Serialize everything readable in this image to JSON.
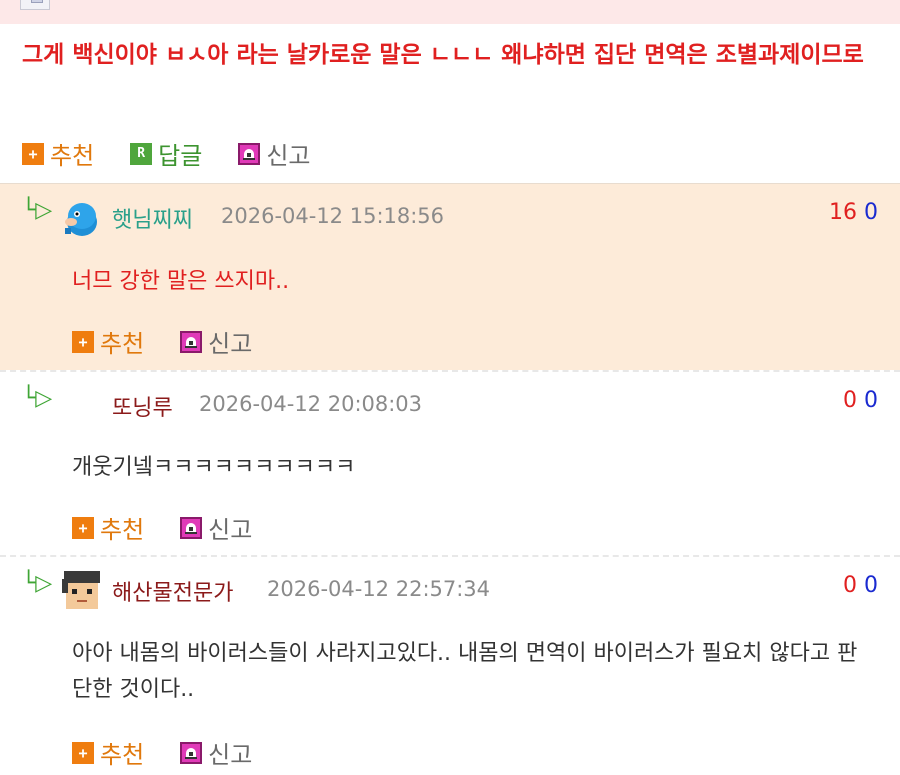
{
  "post": {
    "text": "그게 백신이야 ㅂㅅ아 라는 날카로운 말은 ㄴㄴㄴ 왜냐하면 집단 면역은 조별과제이므로",
    "actions": {
      "recommend": "추천",
      "reply": "답글",
      "report": "신고"
    }
  },
  "comments": [
    {
      "nick": "햇님찌찌",
      "date": "2026-04-12 15:18:56",
      "up": "16",
      "down": "0",
      "text": "너므 강한 말은 쓰지마..",
      "recommend": "추천",
      "report": "신고"
    },
    {
      "nick": "또닝루",
      "date": "2026-04-12 20:08:03",
      "up": "0",
      "down": "0",
      "text": "개웃기넼ㅋㅋㅋㅋㅋㅋㅋㅋㅋㅋ",
      "recommend": "추천",
      "report": "신고"
    },
    {
      "nick": "해산물전문가",
      "date": "2026-04-12 22:57:34",
      "up": "0",
      "down": "0",
      "text": "아아 내몸의 바이러스들이 사라지고있다.. 내몸의 면역이 바이러스가 필요치 않다고 판단한 것이다..",
      "recommend": "추천",
      "report": "신고"
    }
  ],
  "colors": {
    "post_text": "#e02020",
    "highlight_row": "#fdebd9",
    "nick_green": "#2aa08a",
    "nick_maroon": "#8b1a1a",
    "upvote": "#e02020",
    "downvote": "#1a2ad0"
  },
  "icons": {
    "recommend": "plus-box-icon",
    "reply": "r-box-icon",
    "report": "siren-icon",
    "thread": "reply-arrow-icon"
  }
}
